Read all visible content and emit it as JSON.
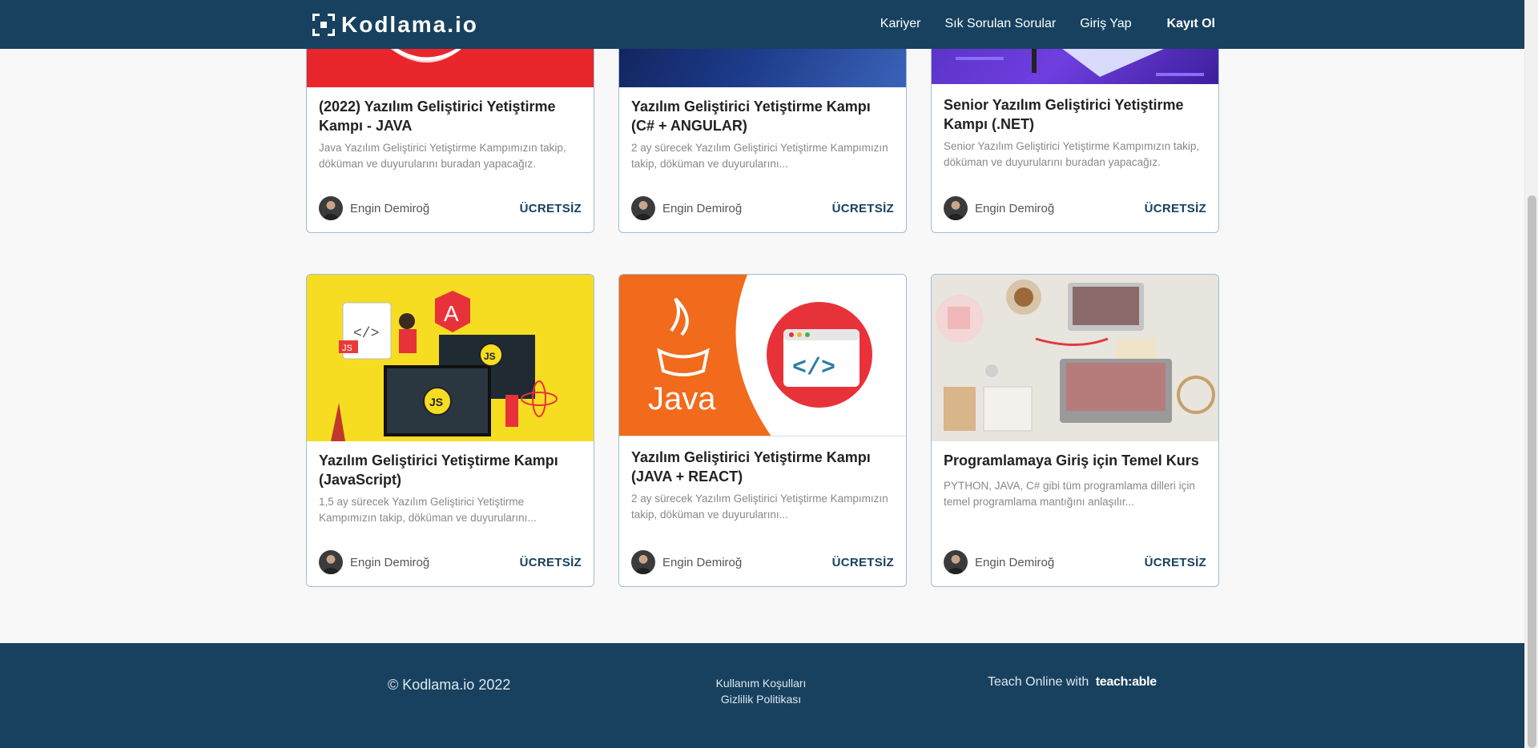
{
  "header": {
    "logo_text": "Kodlama.io",
    "nav": [
      {
        "label": "Kariyer"
      },
      {
        "label": "Sık Sorulan Sorular"
      },
      {
        "label": "Giriş Yap"
      },
      {
        "label": "Kayıt Ol"
      }
    ]
  },
  "courses": [
    {
      "title": "(2022) Yazılım Geliştirici Yetiştirme Kampı - JAVA",
      "description": "Java Yazılım Geliştirici Yetiştirme Kampımızın takip, döküman ve duyurularını buradan yapacağız.",
      "author": "Engin Demiroğ",
      "price": "ÜCRETSİZ",
      "image": "java-camp-red-banner"
    },
    {
      "title": "Yazılım Geliştirici Yetiştirme Kampı (C# + ANGULAR)",
      "description": "2 ay sürecek Yazılım Geliştirici Yetiştirme Kampımızın takip, döküman ve duyurularını...",
      "author": "Engin Demiroğ",
      "price": "ÜCRETSİZ",
      "image": "laptop-dark-blue-banner"
    },
    {
      "title": "Senior Yazılım Geliştirici Yetiştirme Kampı (.NET)",
      "description": "Senior Yazılım Geliştirici Yetiştirme Kampımızın takip, döküman ve duyurularını buradan yapacağız.",
      "author": "Engin Demiroğ",
      "price": "ÜCRETSİZ",
      "image": "purple-isometric-banner"
    },
    {
      "title": "Yazılım Geliştirici Yetiştirme Kampı (JavaScript)",
      "description": "1,5 ay sürecek Yazılım Geliştirici Yetiştirme Kampımızın takip, döküman ve duyurularını...",
      "author": "Engin Demiroğ",
      "price": "ÜCRETSİZ",
      "image": "javascript-yellow-illustration",
      "image_text": {
        "js": "JS",
        "a": "A",
        "code": "</>"
      }
    },
    {
      "title": "Yazılım Geliştirici Yetiştirme Kampı (JAVA + REACT)",
      "description": "2 ay sürecek Yazılım Geliştirici Yetiştirme Kampımızın takip, döküman ve duyurularını...",
      "author": "Engin Demiroğ",
      "price": "ÜCRETSİZ",
      "image": "java-react-orange-banner",
      "image_text": {
        "java": "Java",
        "code": "</>"
      }
    },
    {
      "title": "Programlamaya Giriş için Temel Kurs",
      "description": "PYTHON, JAVA, C# gibi tüm programlama dilleri için temel programlama mantığını anlaşılır...",
      "author": "Engin Demiroğ",
      "price": "ÜCRETSİZ",
      "image": "desk-laptop-photo"
    }
  ],
  "footer": {
    "copyright": "© Kodlama.io 2022",
    "terms": "Kullanım Koşulları",
    "privacy": "Gizlilik Politikası",
    "teach_prefix": "Teach Online with",
    "teach_brand": "teach:able"
  },
  "colors": {
    "header_bg": "#17415f",
    "card_border": "#9fbdd6",
    "price": "#17415f",
    "page_bg": "#f8f8f8"
  }
}
